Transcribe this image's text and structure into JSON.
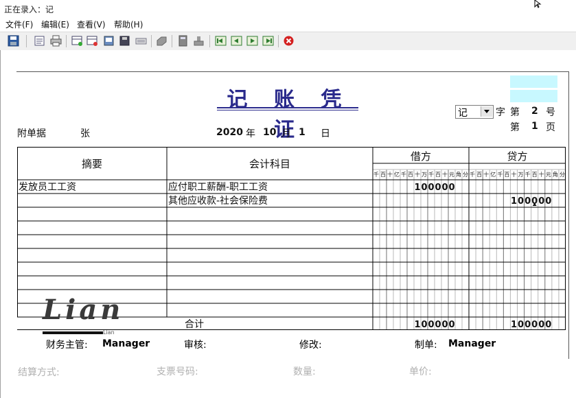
{
  "window": {
    "title": "正在录入：记"
  },
  "menu": [
    "文件(F)",
    "编辑(E)",
    "查看(V)",
    "帮助(H)"
  ],
  "toolbar": {
    "icons": [
      "save-icon",
      "preview-icon",
      "print-icon",
      "insert-row-icon",
      "delete-row-icon",
      "book-icon",
      "floppy-icon",
      "keyboard-icon",
      "puzzle-icon",
      "calculator-icon",
      "stamp-icon",
      "first-record-icon",
      "previous-record-icon",
      "next-record-icon",
      "last-record-icon",
      "close-icon"
    ],
    "accent_color": "#d42020"
  },
  "voucher": {
    "title": "记 账 凭 证",
    "voucher_type": "记",
    "zi": "字",
    "di": "第",
    "number": "2",
    "hao": "号",
    "page": "1",
    "ye": "页",
    "attachments_label": "附单据",
    "attachments_count": "张",
    "date": {
      "year": "2020",
      "year_label": "年",
      "month": "10",
      "month_label": "月",
      "day": "1",
      "day_label": "日"
    },
    "columns": {
      "summary": "摘要",
      "account": "会计科目",
      "debit": "借方",
      "credit": "贷方"
    },
    "digit_headers": [
      "千",
      "百",
      "十",
      "亿",
      "千",
      "百",
      "十",
      "万",
      "千",
      "百",
      "十",
      "元",
      "角",
      "分"
    ],
    "entries": [
      {
        "summary": "发放员工工资",
        "account": "应付职工薪酬-职工工资",
        "debit": "100000",
        "credit": ""
      },
      {
        "summary": "",
        "account": "其他应收款-社会保险费",
        "debit": "",
        "credit": "100000"
      },
      {
        "summary": "",
        "account": "",
        "debit": "",
        "credit": ""
      },
      {
        "summary": "",
        "account": "",
        "debit": "",
        "credit": ""
      },
      {
        "summary": "",
        "account": "",
        "debit": "",
        "credit": ""
      },
      {
        "summary": "",
        "account": "",
        "debit": "",
        "credit": ""
      },
      {
        "summary": "",
        "account": "",
        "debit": "",
        "credit": ""
      },
      {
        "summary": "",
        "account": "",
        "debit": "",
        "credit": ""
      },
      {
        "summary": "",
        "account": "",
        "debit": "",
        "credit": ""
      },
      {
        "summary": "",
        "account": "",
        "debit": "",
        "credit": ""
      }
    ],
    "total": {
      "label": "合计",
      "debit": "100000",
      "credit": "100000"
    },
    "footer": {
      "supervisor_label": "财务主管:",
      "supervisor": "Manager",
      "review_label": "审核:",
      "modify_label": "修改:",
      "preparer_label": "制单:",
      "preparer": "Manager"
    }
  },
  "bottom": {
    "settlement": "结算方式:",
    "check_no": "支票号码:",
    "quantity": "数量:",
    "unit_price": "单价:"
  },
  "watermark": {
    "logo": "Lian",
    "small": "Lian"
  }
}
